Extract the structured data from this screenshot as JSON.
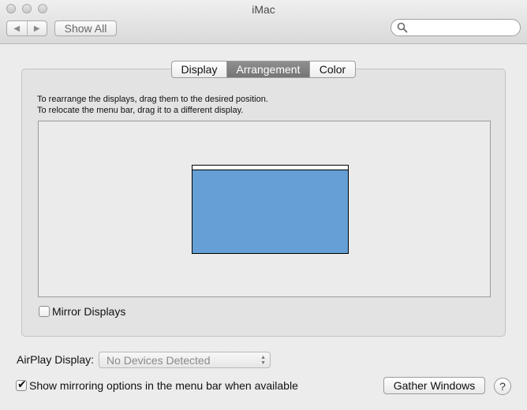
{
  "window": {
    "title": "iMac"
  },
  "toolbar": {
    "back_glyph": "◀",
    "forward_glyph": "▶",
    "show_all_label": "Show All",
    "search": {
      "value": "",
      "placeholder": ""
    }
  },
  "tabs": [
    {
      "label": "Display",
      "active": false
    },
    {
      "label": "Arrangement",
      "active": true
    },
    {
      "label": "Color",
      "active": false
    }
  ],
  "arrangement": {
    "instruction_1": "To rearrange the displays, drag them to the desired position.",
    "instruction_2": "To relocate the menu bar, drag it to a different display.",
    "display_color": "#659fd6",
    "menubar_color": "#ffffff"
  },
  "mirror_displays": {
    "label": "Mirror Displays",
    "checked": false
  },
  "airplay": {
    "label": "AirPlay Display:",
    "selected": "No Devices Detected"
  },
  "show_mirroring": {
    "label": "Show mirroring options in the menu bar when available",
    "checked": true,
    "mark": "✔"
  },
  "gather_windows_label": "Gather Windows",
  "help_label": "?"
}
